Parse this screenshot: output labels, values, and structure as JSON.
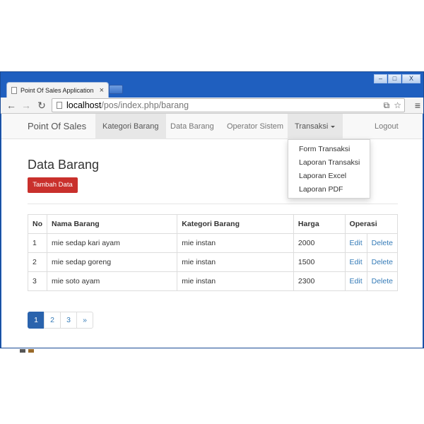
{
  "browser": {
    "tab_title": "Point Of Sales Application",
    "url_host": "localhost",
    "url_path": "/pos/index.php/barang",
    "window_controls": [
      "–",
      "□",
      "X"
    ]
  },
  "navbar": {
    "brand": "Point Of Sales",
    "items": [
      {
        "label": "Kategori Barang"
      },
      {
        "label": "Data Barang"
      },
      {
        "label": "Operator Sistem"
      },
      {
        "label": "Transaksi"
      }
    ],
    "logout": "Logout"
  },
  "dropdown": {
    "items": [
      "Form Transaksi",
      "Laporan Transaksi",
      "Laporan Excel",
      "Laporan PDF"
    ]
  },
  "main": {
    "title": "Data Barang",
    "add_button": "Tambah Data"
  },
  "table": {
    "headers": [
      "No",
      "Nama Barang",
      "Kategori Barang",
      "Harga",
      "Operasi"
    ],
    "rows": [
      {
        "no": "1",
        "nama": "mie sedap kari ayam",
        "kategori": "mie instan",
        "harga": "2000",
        "edit": "Edit",
        "delete": "Delete"
      },
      {
        "no": "2",
        "nama": "mie sedap goreng",
        "kategori": "mie instan",
        "harga": "1500",
        "edit": "Edit",
        "delete": "Delete"
      },
      {
        "no": "3",
        "nama": "mie soto ayam",
        "kategori": "mie instan",
        "harga": "2300",
        "edit": "Edit",
        "delete": "Delete"
      }
    ]
  },
  "pagination": {
    "pages": [
      "1",
      "2",
      "3"
    ],
    "next": "»",
    "active": "1"
  },
  "colors": {
    "accent_red": "#c9302c",
    "link_blue": "#337ab7",
    "window_blue": "#1f5fbf"
  }
}
